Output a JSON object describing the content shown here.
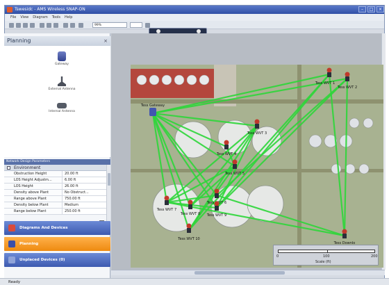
{
  "window": {
    "title": "Tswesidc - AMS Wireless SNAP-ON"
  },
  "menu": [
    "File",
    "View",
    "Diagram",
    "Tools",
    "Help"
  ],
  "toolbar": {
    "zoom_value": "99%"
  },
  "left_panel": {
    "title": "Planning",
    "palette": [
      {
        "label": "Gateway",
        "icon": "gateway-icon"
      },
      {
        "label": "External Antenna",
        "icon": "external-antenna-icon"
      },
      {
        "label": "Internal Antenna",
        "icon": "internal-antenna-icon"
      }
    ]
  },
  "params": {
    "header": "Network Design Parameters",
    "group": "Environment",
    "rows": [
      {
        "name": "Obstruction Height",
        "value": "20.00 ft"
      },
      {
        "name": "LOS Height Adjustm...",
        "value": "6.00 ft"
      },
      {
        "name": "LOS Height",
        "value": "26.00 ft"
      },
      {
        "name": "Density above Plant",
        "value": "No Obstruct..."
      },
      {
        "name": "Range above Plant",
        "value": "750.00 ft"
      },
      {
        "name": "Density below Plant",
        "value": "Medium"
      },
      {
        "name": "Range below Plant",
        "value": "250.00 ft"
      }
    ]
  },
  "nav": [
    {
      "label": "Diagrams And Devices",
      "style": "blue"
    },
    {
      "label": "Planning",
      "style": "orange"
    },
    {
      "label": "Unplaced Devices (0)",
      "style": "blue"
    }
  ],
  "map": {
    "devices": [
      {
        "id": "gw",
        "label": "Tess Gateway",
        "type": "gateway"
      },
      {
        "id": "d1",
        "label": "Tess WVT 1",
        "type": "field"
      },
      {
        "id": "d2",
        "label": "Tess WVT 2",
        "type": "field"
      },
      {
        "id": "d3",
        "label": "Tess WVT 3",
        "type": "field"
      },
      {
        "id": "d4",
        "label": "Tess WVT 4",
        "type": "field"
      },
      {
        "id": "d5",
        "label": "Tess WVT 5",
        "type": "field"
      },
      {
        "id": "d6",
        "label": "Tess WVT 6",
        "type": "field"
      },
      {
        "id": "d7",
        "label": "Tess WVT 7",
        "type": "field"
      },
      {
        "id": "d8",
        "label": "Tess WVT 8",
        "type": "field"
      },
      {
        "id": "d9",
        "label": "Tess WVT 9",
        "type": "field"
      },
      {
        "id": "d10",
        "label": "Tess WVT 10",
        "type": "field"
      },
      {
        "id": "d11",
        "label": "Tess Downlo",
        "type": "field"
      }
    ],
    "link_color": "#2ed63a",
    "links": [
      [
        "gw",
        "d1"
      ],
      [
        "gw",
        "d2"
      ],
      [
        "gw",
        "d3"
      ],
      [
        "gw",
        "d4"
      ],
      [
        "gw",
        "d5"
      ],
      [
        "gw",
        "d6"
      ],
      [
        "gw",
        "d7"
      ],
      [
        "gw",
        "d8"
      ],
      [
        "gw",
        "d9"
      ],
      [
        "gw",
        "d10"
      ],
      [
        "d9",
        "d1"
      ],
      [
        "d9",
        "d2"
      ],
      [
        "d9",
        "d3"
      ],
      [
        "d9",
        "d7"
      ],
      [
        "d10",
        "d1"
      ],
      [
        "d10",
        "d3"
      ],
      [
        "d10",
        "d5"
      ],
      [
        "d11",
        "d1"
      ],
      [
        "d11",
        "d2"
      ],
      [
        "d11",
        "d6"
      ],
      [
        "d11",
        "d7"
      ],
      [
        "d5",
        "d7"
      ],
      [
        "d3",
        "d7"
      ],
      [
        "d6",
        "d7"
      ],
      [
        "d4",
        "d5"
      ],
      [
        "d8",
        "d5"
      ],
      [
        "d8",
        "d3"
      ],
      [
        "d2",
        "d6"
      ]
    ]
  },
  "scale": {
    "ticks": [
      "0",
      "100",
      "200"
    ],
    "label": "Scale (ft)"
  },
  "status": {
    "text": "Ready"
  },
  "colors": {
    "title_bar": "#3a5bb5",
    "active_nav": "#f59a1e",
    "link": "#2ed63a"
  }
}
